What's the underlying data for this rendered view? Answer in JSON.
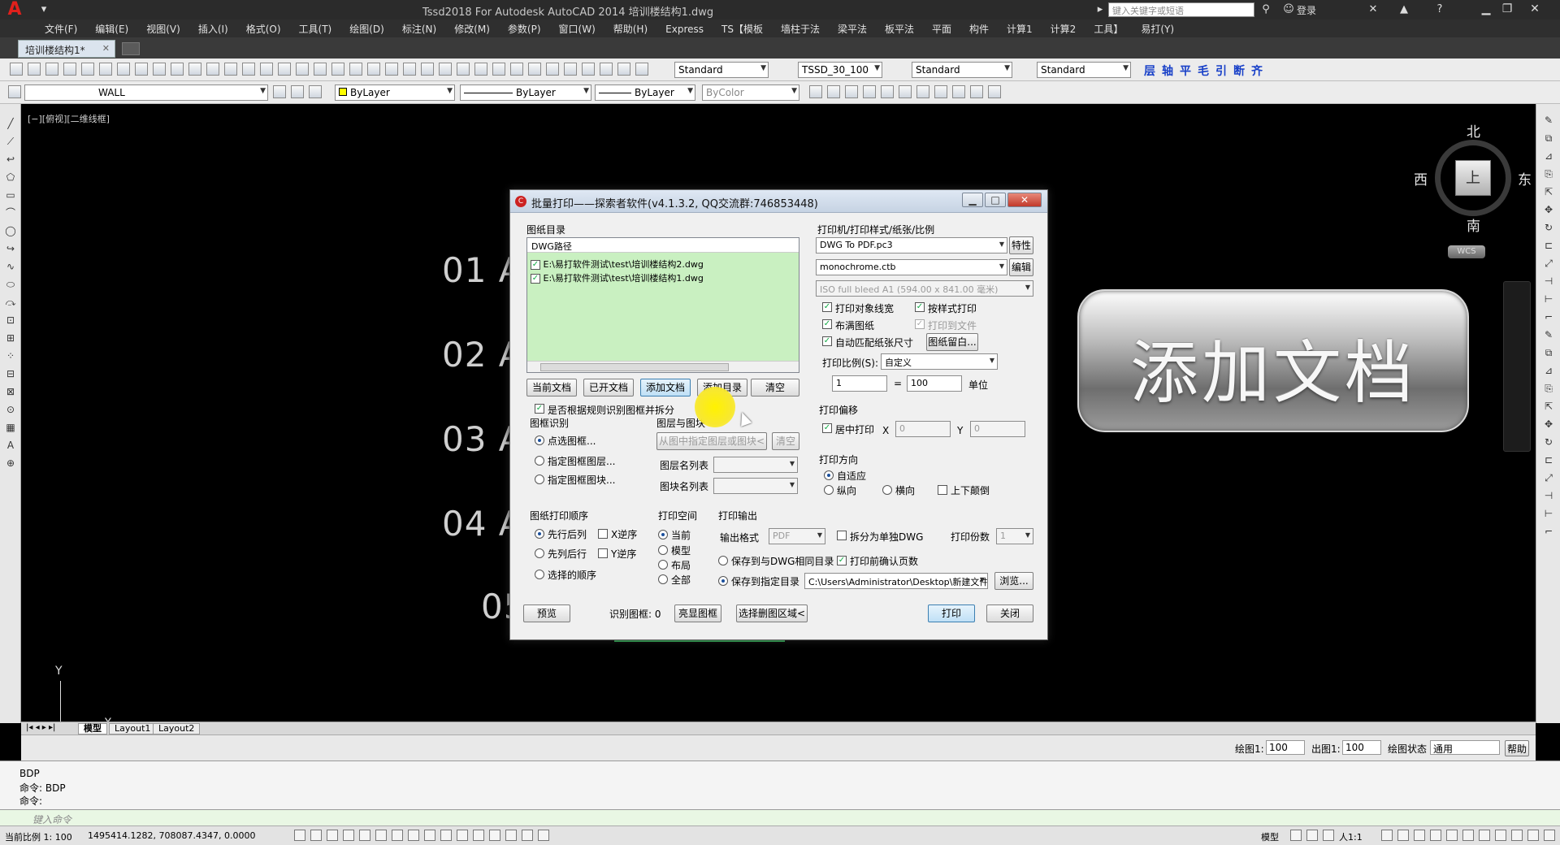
{
  "window": {
    "title": "Tssd2018 For Autodesk AutoCAD 2014    培训楼结构1.dwg",
    "search_placeholder": "键入关键字或短语",
    "login": "登录"
  },
  "menu": [
    "文件(F)",
    "编辑(E)",
    "视图(V)",
    "插入(I)",
    "格式(O)",
    "工具(T)",
    "绘图(D)",
    "标注(N)",
    "修改(M)",
    "参数(P)",
    "窗口(W)",
    "帮助(H)",
    "Express",
    "TS【模板",
    "墙柱于法",
    "梁平法",
    "板平法",
    "平面",
    "构件",
    "计算1",
    "计算2",
    "工具】",
    "易打(Y)"
  ],
  "doc_tab": "培训楼结构1*",
  "toolbar1": {
    "text_style": "Standard",
    "dim_style": "TSSD_30_100",
    "table_style": "Standard",
    "ml_style": "Standard",
    "tssd_icons": [
      "层",
      "轴",
      "平",
      "毛",
      "引",
      "断",
      "齐"
    ]
  },
  "toolbar2": {
    "layer": "WALL",
    "color": "ByLayer",
    "linetype": "ByLayer",
    "lineweight": "ByLayer",
    "plotstyle": "ByColor"
  },
  "canvas": {
    "view_label": "[−][俯视][二维线框]",
    "dim_labels": [
      "01 A",
      "02 A",
      "03 A",
      "04 A",
      "05"
    ],
    "compass": {
      "n": "北",
      "s": "南",
      "e": "东",
      "w": "西",
      "top": "上"
    },
    "wcs": "WCS",
    "ucs_y": "Y",
    "ucs_x": "X",
    "overlay_text": "添加文档"
  },
  "layout_tabs": [
    "模型",
    "Layout1",
    "Layout2"
  ],
  "scale_strip": {
    "draw_label": "绘图1:",
    "draw_value": "100",
    "out_label": "出图1:",
    "out_value": "100",
    "state_label": "绘图状态",
    "state_value": "通用",
    "help": "帮助"
  },
  "command": {
    "lines": [
      "BDP",
      "命令:  BDP",
      "命令:"
    ],
    "placeholder": "键入命令"
  },
  "statusbar": {
    "scale": "当前比例 1: 100",
    "coords": "1495414.1282, 708087.4347, 0.0000",
    "model": "模型",
    "anno": "人1:1"
  },
  "dialog": {
    "title": "批量打印——探索者软件(v4.1.3.2, QQ交流群:746853448)",
    "list_group": "图纸目录",
    "list_header": "DWG路径",
    "files": [
      "E:\\易打软件测试\\test\\培训楼结构2.dwg",
      "E:\\易打软件测试\\test\\培训楼结构1.dwg"
    ],
    "list_buttons": [
      "当前文档",
      "已开文档",
      "添加文档",
      "添加目录",
      "清空"
    ],
    "split_check": "是否根据规则识别图框并拆分",
    "frame_group": "图框识别",
    "frame_options": [
      "点选图框...",
      "指定图框图层...",
      "指定图框图块..."
    ],
    "layer_block_group": "图层与图块",
    "layer_block_btn": "从图中指定图层或图块<",
    "layer_block_clear": "清空",
    "layer_list_label": "图层名列表",
    "block_list_label": "图块名列表",
    "order_group": "图纸打印顺序",
    "order_options": [
      "先行后列",
      "先列后行",
      "选择的顺序"
    ],
    "x_reverse": "X逆序",
    "y_reverse": "Y逆序",
    "space_group": "打印空间",
    "space_options": [
      "当前",
      "模型",
      "布局",
      "全部"
    ],
    "output_group": "打印输出",
    "output_format_label": "输出格式",
    "output_format": "PDF",
    "split_dwg": "拆分为单独DWG",
    "copies_label": "打印份数",
    "copies": "1",
    "save_same": "保存到与DWG相同目录",
    "confirm_pages": "打印前确认页数",
    "save_to": "保存到指定目录",
    "save_path": "C:\\Users\\Administrator\\Desktop\\新建文件夹",
    "browse": "浏览...",
    "printer_group": "打印机/打印样式/纸张/比例",
    "printer": "DWG To PDF.pc3",
    "printer_btn": "特性",
    "plotstyle": "monochrome.ctb",
    "plotstyle_btn": "编辑",
    "paper": "ISO full bleed A1 (594.00 x 841.00 毫米)",
    "checks": [
      "打印对象线宽",
      "按样式打印",
      "布满图纸",
      "打印到文件",
      "自动匹配纸张尺寸"
    ],
    "margin_btn": "图纸留白...",
    "scale_label": "打印比例(S):",
    "scale_value": "自定义",
    "scale_a": "1",
    "scale_eq": "=",
    "scale_b": "100",
    "scale_unit": "单位",
    "offset_group": "打印偏移",
    "center": "居中打印",
    "x_label": "X",
    "x_value": "0",
    "y_label": "Y",
    "y_value": "0",
    "orient_group": "打印方向",
    "orient_options": [
      "自适应",
      "纵向",
      "横向"
    ],
    "flip": "上下颠倒",
    "preview": "预览",
    "frames_label": "识别图框: 0",
    "highlight": "亮显图框",
    "select_area": "选择删图区域<",
    "print": "打印",
    "close": "关闭"
  }
}
